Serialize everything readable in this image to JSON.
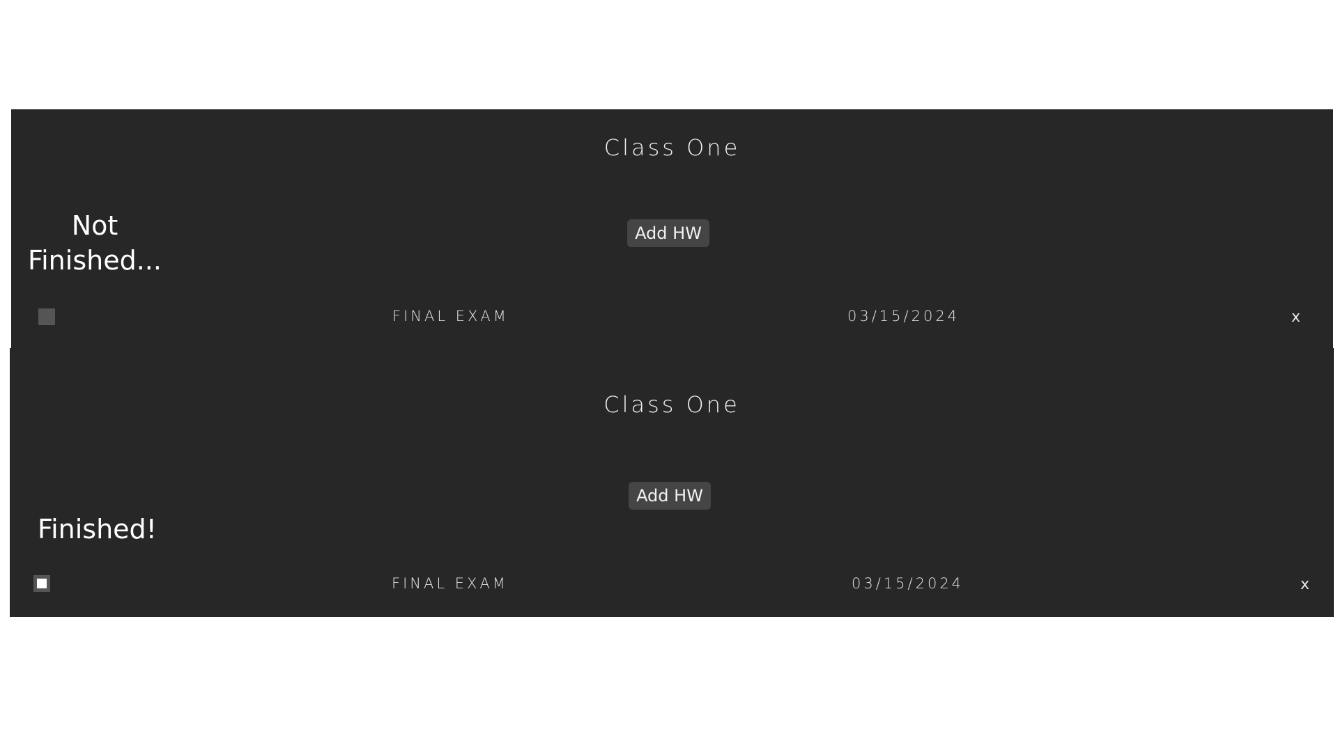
{
  "cards": [
    {
      "class_title": "Class One",
      "add_button_label": "Add HW",
      "status_text": "Not Finished...",
      "homework": {
        "name": "FINAL EXAM",
        "due_date": "03/15/2024",
        "completed": false,
        "delete_label": "x"
      }
    },
    {
      "class_title": "Class One",
      "add_button_label": "Add HW",
      "status_text": "Finished!",
      "homework": {
        "name": "FINAL EXAM",
        "due_date": "03/15/2024",
        "completed": true,
        "delete_label": "x"
      }
    }
  ],
  "colors": {
    "page_background": "#ffffff",
    "panel_background": "#272727",
    "button_background": "#454545",
    "checkbox_gray": "#555555",
    "text": "#ffffff"
  }
}
